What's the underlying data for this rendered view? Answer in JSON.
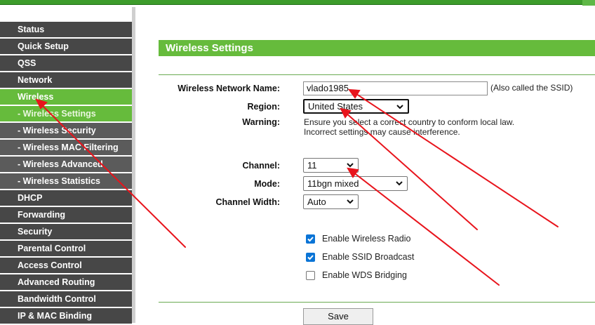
{
  "sidebar": {
    "items": [
      {
        "label": "Status"
      },
      {
        "label": "Quick Setup"
      },
      {
        "label": "QSS"
      },
      {
        "label": "Network"
      },
      {
        "label": "Wireless"
      },
      {
        "label": "- Wireless Settings"
      },
      {
        "label": "- Wireless Security"
      },
      {
        "label": "- Wireless MAC Filtering"
      },
      {
        "label": "- Wireless Advanced"
      },
      {
        "label": "- Wireless Statistics"
      },
      {
        "label": "DHCP"
      },
      {
        "label": "Forwarding"
      },
      {
        "label": "Security"
      },
      {
        "label": "Parental Control"
      },
      {
        "label": "Access Control"
      },
      {
        "label": "Advanced Routing"
      },
      {
        "label": "Bandwidth Control"
      },
      {
        "label": "IP & MAC Binding"
      }
    ],
    "active_item": "Wireless",
    "active_subitem": "- Wireless Settings"
  },
  "main": {
    "title": "Wireless Settings",
    "ssid": {
      "label": "Wireless Network Name:",
      "value": "vlado1985",
      "hint": "(Also called the SSID)"
    },
    "region": {
      "label": "Region:",
      "value": "United States"
    },
    "warning": {
      "label": "Warning:",
      "line1": "Ensure you select a correct country to conform local law.",
      "line2": "Incorrect settings may cause interference."
    },
    "channel": {
      "label": "Channel:",
      "value": "11"
    },
    "mode": {
      "label": "Mode:",
      "value": "11bgn mixed"
    },
    "channel_width": {
      "label": "Channel Width:",
      "value": "Auto"
    },
    "checkboxes": [
      {
        "label": "Enable Wireless Radio",
        "checked": true
      },
      {
        "label": "Enable SSID Broadcast",
        "checked": true
      },
      {
        "label": "Enable WDS Bridging",
        "checked": false
      }
    ],
    "save_label": "Save"
  },
  "colors": {
    "accent_green": "#66bb3c",
    "menu_dark": "#474747",
    "checkbox_blue": "#0a74d6",
    "annotation_red": "#e8141c"
  }
}
